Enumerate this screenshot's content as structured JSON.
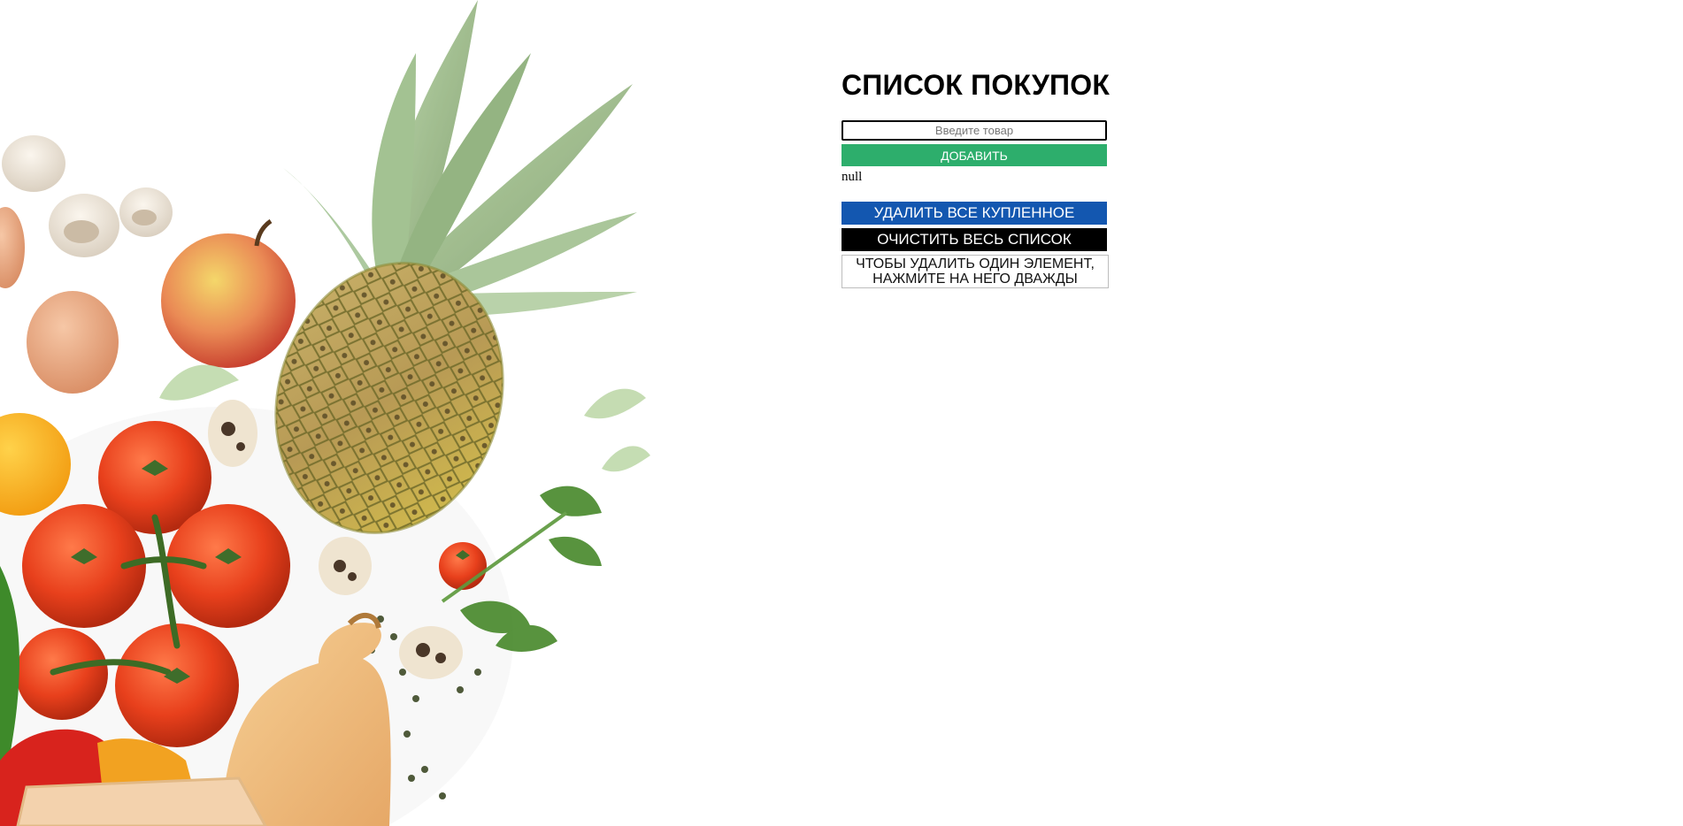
{
  "app": {
    "title": "СПИСОК ПОКУПОК",
    "input": {
      "placeholder": "Введите товар",
      "value": ""
    },
    "add_button_label": "ДОБАВИТЬ",
    "list_output": "null",
    "remove_bought_label": "УДАЛИТЬ ВСЕ КУПЛЕННОЕ",
    "clear_all_label": "ОЧИСТИТЬ ВЕСЬ СПИСОК",
    "hint": "ЧТОБЫ УДАЛИТЬ ОДИН ЭЛЕМЕНТ, НАЖМИТЕ НА НЕГО ДВАЖДЫ"
  },
  "colors": {
    "background": "#ffffff",
    "add_button": "#2dae6c",
    "remove_bought_button": "#1357b0",
    "clear_button": "#000000",
    "hint_border": "#bdbdbd"
  },
  "illustration": {
    "subject": "fresh produce (pineapple, tomatoes, apple, mushrooms, eggs, squash, pepper, parsley)"
  }
}
